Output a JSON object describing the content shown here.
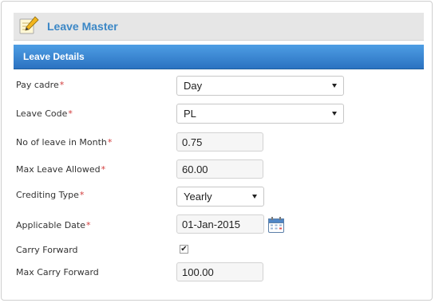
{
  "page": {
    "title": "Leave Master",
    "section_title": "Leave Details",
    "title_icon": "edit-note-icon"
  },
  "form": {
    "required_mark": "*",
    "pay_cadre": {
      "label": "Pay cadre",
      "value": "Day"
    },
    "leave_code": {
      "label": "Leave Code",
      "value": "PL"
    },
    "no_of_leave_in_month": {
      "label": "No of leave in Month",
      "value": "0.75"
    },
    "max_leave_allowed": {
      "label": "Max Leave Allowed",
      "value": "60.00"
    },
    "crediting_type": {
      "label": "Crediting Type",
      "value": "Yearly"
    },
    "applicable_date": {
      "label": "Applicable Date",
      "value": "01-Jan-2015",
      "icon": "calendar-icon"
    },
    "carry_forward": {
      "label": "Carry Forward",
      "checked": true,
      "check_glyph": "✔"
    },
    "max_carry_forward": {
      "label": "Max Carry Forward",
      "value": "100.00"
    }
  },
  "colors": {
    "title_text": "#3b87c6",
    "section_bar": "#2b72c1",
    "required": "#d23b3b"
  }
}
